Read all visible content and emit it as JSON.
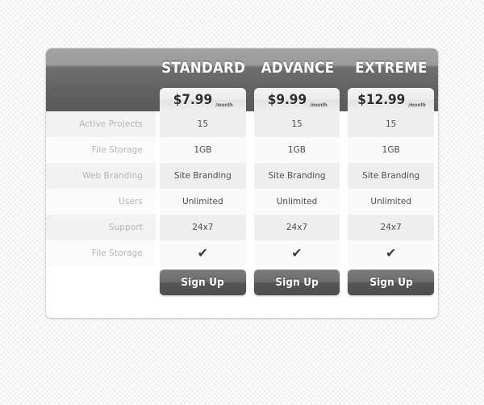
{
  "page": {
    "background_color": "#f1f1f1",
    "card_background": "#ffffff"
  },
  "table": {
    "header": {
      "background_top_color": "#a2a2a2",
      "background_bottom_color": "#5a5a5a",
      "title_color": "#ffffff"
    },
    "plans": [
      {
        "name": "STANDARD",
        "price": "$7.99",
        "period": "/month",
        "cta_label": "Sign Up",
        "features": [
          "15",
          "1GB",
          "Site Branding",
          "Unlimited",
          "24x7",
          "check-mark"
        ]
      },
      {
        "name": "ADVANCE",
        "price": "$9.99",
        "period": "/month",
        "cta_label": "Sign Up",
        "features": [
          "15",
          "1GB",
          "Site Branding",
          "Unlimited",
          "24x7",
          "check-mark"
        ]
      },
      {
        "name": "EXTREME",
        "price": "$12.99",
        "period": "/month",
        "cta_label": "Sign Up",
        "features": [
          "15",
          "1GB",
          "Site Branding",
          "Unlimited",
          "24x7",
          "check-mark"
        ]
      }
    ],
    "feature_labels": [
      "Active Projects",
      "File Storage",
      "Web Branding",
      "Users",
      "Support",
      "File Storage"
    ],
    "check_glyph": "✔",
    "label_color": "#b4b4b4",
    "value_color": "#4a4a4a",
    "button_color": "#606060"
  }
}
